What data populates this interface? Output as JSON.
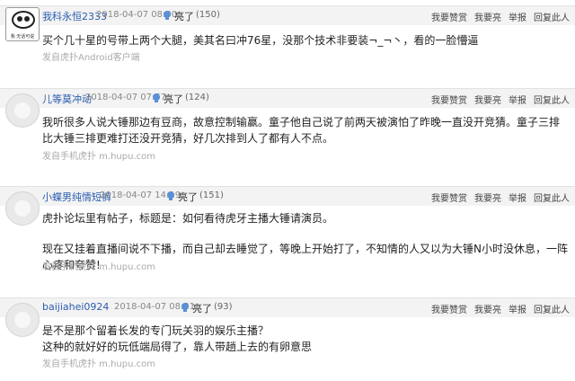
{
  "posts": [
    {
      "username": "我科永恒2333",
      "timestamp": "2018-04-07 08:00",
      "light_label": "亮了",
      "light_count": "(150)",
      "actions": {
        "appreciate": "我要赞赏",
        "light": "我要亮",
        "report": "举报",
        "reply": "回复此人"
      },
      "avatar_caption": "我 无话可说",
      "body": [
        "买个几十星的号带上两个大腿，美其名曰冲76星，没那个技术非要装¬_¬丶，看的一脸懵逼"
      ],
      "source": "发自虎扑Android客户端"
    },
    {
      "username": "儿等莫冲动",
      "timestamp": "2018-04-07 07:57",
      "light_label": "亮了",
      "light_count": "(124)",
      "actions": {
        "appreciate": "我要赞赏",
        "light": "我要亮",
        "report": "举报",
        "reply": "回复此人"
      },
      "body": [
        "我听很多人说大锤那边有豆商，故意控制输赢。童子他自己说了前两天被演怕了昨晚一直没开竞猜。童子三排比大锤三排更难打还没开竞猜，好几次排到人了都有人不点。"
      ],
      "source": "发自手机虎扑 m.hupu.com"
    },
    {
      "username": "小蝶男纯情短裤",
      "timestamp": "2018-04-07 14:19",
      "light_label": "亮了",
      "light_count": "(151)",
      "actions": {
        "appreciate": "我要赞赏",
        "light": "我要亮",
        "report": "举报",
        "reply": "回复此人"
      },
      "body": [
        "虎扑论坛里有帖子，标题是：如何看待虎牙主播大锤请演员。",
        "现在又挂着直播间说不下播，而自己却去睡觉了，等晚上开始打了，不知情的人又以为大锤N小时没休息，一阵心疼和夸赞!"
      ],
      "source": "发自手机虎扑 m.hupu.com"
    },
    {
      "username": "baijiahei0924",
      "timestamp": "2018-04-07 08:31",
      "light_label": "亮了",
      "light_count": "(93)",
      "actions": {
        "appreciate": "我要赞赏",
        "light": "我要亮",
        "report": "举报",
        "reply": "回复此人"
      },
      "body": [
        "是不是那个留着长发的专门玩关羽的娱乐主播？",
        "这种的就好好的玩低端局得了，靠人带趟上去的有卵意思"
      ],
      "source": "发自手机虎扑 m.hupu.com"
    }
  ]
}
